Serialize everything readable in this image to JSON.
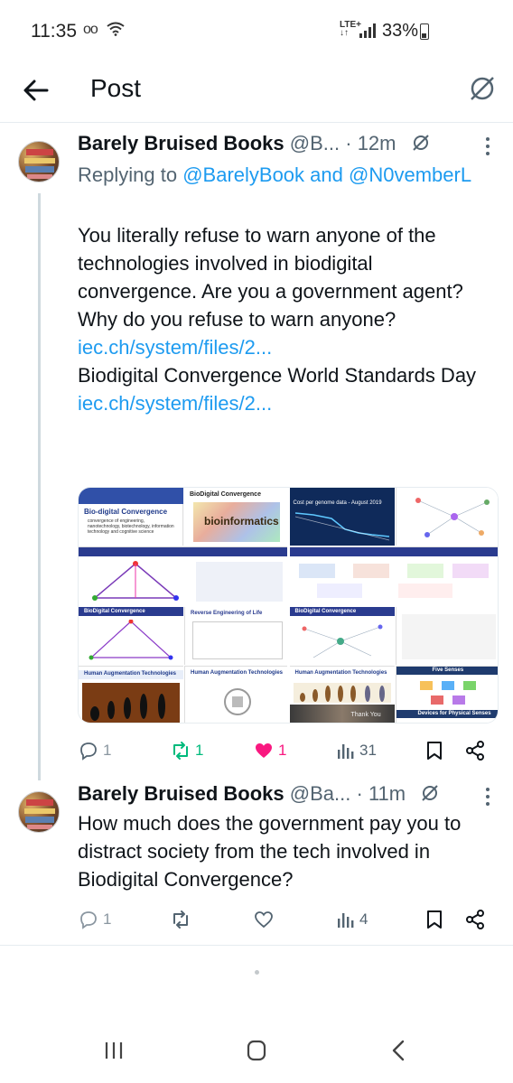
{
  "status_bar": {
    "time": "11:35",
    "voicemail_icon": "voicemail-icon",
    "wifi_icon": "wifi-icon",
    "network_top": "LTE+",
    "network_bottom": "↓↑",
    "battery": "33%",
    "battery_level": 0.33
  },
  "header": {
    "title": "Post",
    "back_icon": "arrow-left-icon",
    "action_icon": "muted-circle-icon"
  },
  "tweets": [
    {
      "author_name": "Barely Bruised Books",
      "author_handle": "@B...",
      "separator": "·",
      "time": "12m",
      "replying_prefix": "Replying to",
      "replying_1": "@BarelyBook",
      "replying_and": "and",
      "replying_2": "@N0vemberL",
      "text": "You literally refuse to warn anyone of the technologies involved in biodigital convergence. Are you a government agent? Why do you refuse to warn anyone?",
      "link_1": "iec.ch/system/files/2...",
      "text_2": "Biodigital Convergence World Standards Day",
      "link_2": "iec.ch/system/files/2...",
      "media": [
        {
          "title": "Bio-digital Convergence",
          "subtitle": "convergence of engineering, nanotechnology, biotechnology, information technology and cognitive science",
          "slide_2_title": "BioDigital Convergence",
          "slide_2_word": "bioinformatics"
        },
        {
          "title": "Cost per genome data - August 2019",
          "slide_2_title": ""
        },
        {
          "title": "BioDigital Convergence",
          "slide_2_title": "Reverse Engineering of Life",
          "slide_3_title": "Human Augmentation Technologies",
          "slide_4_title": "Human Augmentation Technologies"
        },
        {
          "title": "BioDigital Convergence",
          "slide_2_title": "Human Augmentation Technologies",
          "slide_3_title": "Five Senses",
          "slide_4_title": "Devices for Physical Senses",
          "slide_5_title": "Thank You"
        }
      ],
      "replies": "1",
      "retweets": "1",
      "likes": "1",
      "views": "31"
    },
    {
      "author_name": "Barely Bruised Books",
      "author_handle": "@Ba...",
      "separator": "·",
      "time": "11m",
      "text": "How much does the government pay you to distract society from the tech involved in Biodigital Convergence?",
      "replies": "1",
      "retweets": "",
      "likes": "",
      "views": "4"
    }
  ],
  "colors": {
    "link": "#1d9bf0",
    "like": "#f91880",
    "retweet": "#00ba7c",
    "muted_text": "#536471"
  }
}
